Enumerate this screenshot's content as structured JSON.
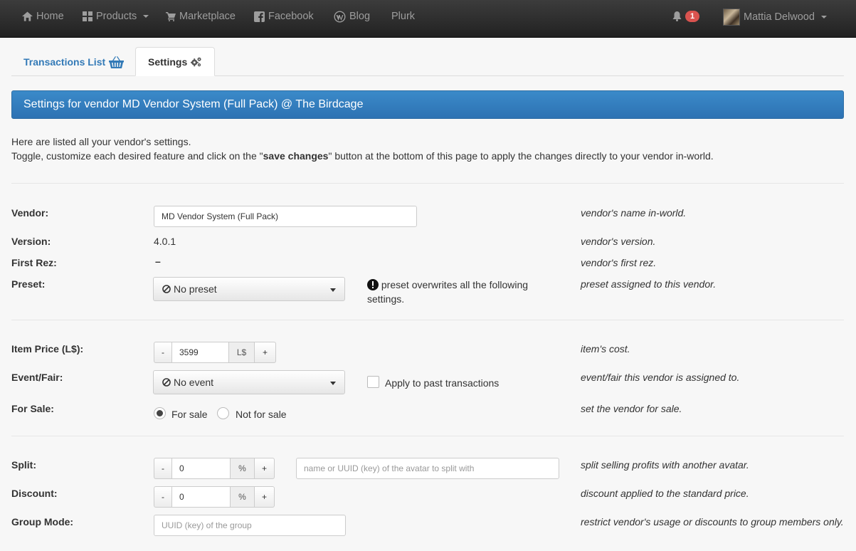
{
  "navbar": {
    "home": "Home",
    "products": "Products",
    "marketplace": "Marketplace",
    "facebook": "Facebook",
    "blog": "Blog",
    "plurk": "Plurk",
    "notifications_count": "1",
    "user_name": "Mattia Delwood"
  },
  "tabs": {
    "transactions": "Transactions List",
    "settings": "Settings"
  },
  "panel": {
    "title": "Settings for vendor MD Vendor System (Full Pack) @ The Birdcage"
  },
  "intro": {
    "line1": "Here are listed all your vendor's settings.",
    "line2_pre": "Toggle, customize each desired feature and click on the \"",
    "line2_bold": "save changes",
    "line2_post": "\" button at the bottom of this page to apply the changes directly to your vendor in-world."
  },
  "fields": {
    "vendor": {
      "label": "Vendor:",
      "value": "MD Vendor System (Full Pack)",
      "desc": "vendor's name in-world."
    },
    "version": {
      "label": "Version:",
      "value": "4.0.1",
      "desc": "vendor's version."
    },
    "first_rez": {
      "label": "First Rez:",
      "value": "–",
      "desc": "vendor's first rez."
    },
    "preset": {
      "label": "Preset:",
      "value": "No preset",
      "note": "preset overwrites all the following settings.",
      "desc": "preset assigned to this vendor."
    },
    "item_price": {
      "label": "Item Price (L$):",
      "minus": "-",
      "value": "3599",
      "unit": "L$",
      "plus": "+",
      "desc": "item's cost."
    },
    "event": {
      "label": "Event/Fair:",
      "value": "No event",
      "checkbox_label": "Apply to past transactions",
      "desc": "event/fair this vendor is assigned to."
    },
    "for_sale": {
      "label": "For Sale:",
      "option_on": "For sale",
      "option_off": "Not for sale",
      "desc": "set the vendor for sale."
    },
    "split": {
      "label": "Split:",
      "minus": "-",
      "value": "0",
      "unit": "%",
      "plus": "+",
      "placeholder": "name or UUID (key) of the avatar to split with",
      "desc": "split selling profits with another avatar."
    },
    "discount": {
      "label": "Discount:",
      "minus": "-",
      "value": "0",
      "unit": "%",
      "plus": "+",
      "desc": "discount applied to the standard price."
    },
    "group_mode": {
      "label": "Group Mode:",
      "placeholder": "UUID (key) of the group",
      "desc": "restrict vendor's usage or discounts to group members only."
    }
  }
}
